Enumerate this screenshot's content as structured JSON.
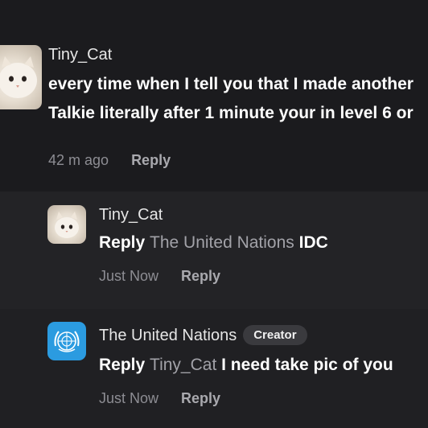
{
  "comments": [
    {
      "author": "Tiny_Cat",
      "lines": [
        "every time when I tell you that I made another",
        "Talkie literally after 1 minute your in level 6 or"
      ],
      "time": "42 m ago",
      "reply_label": "Reply",
      "avatar_icon": "cat-avatar"
    }
  ],
  "replies": [
    {
      "author": "Tiny_Cat",
      "prefix": "Reply",
      "mention": "The United Nations",
      "text": "IDC",
      "time": "Just Now",
      "reply_label": "Reply",
      "avatar_icon": "cat-avatar"
    },
    {
      "author": "The United Nations",
      "badge": "Creator",
      "prefix": "Reply",
      "mention": "Tiny_Cat",
      "text": "I need take pic of you",
      "time": "Just Now",
      "reply_label": "Reply",
      "avatar_icon": "un-emblem-avatar"
    }
  ],
  "colors": {
    "background": "#1b1b1e",
    "reply_background": "#232326",
    "un_blue": "#2b9be0"
  }
}
